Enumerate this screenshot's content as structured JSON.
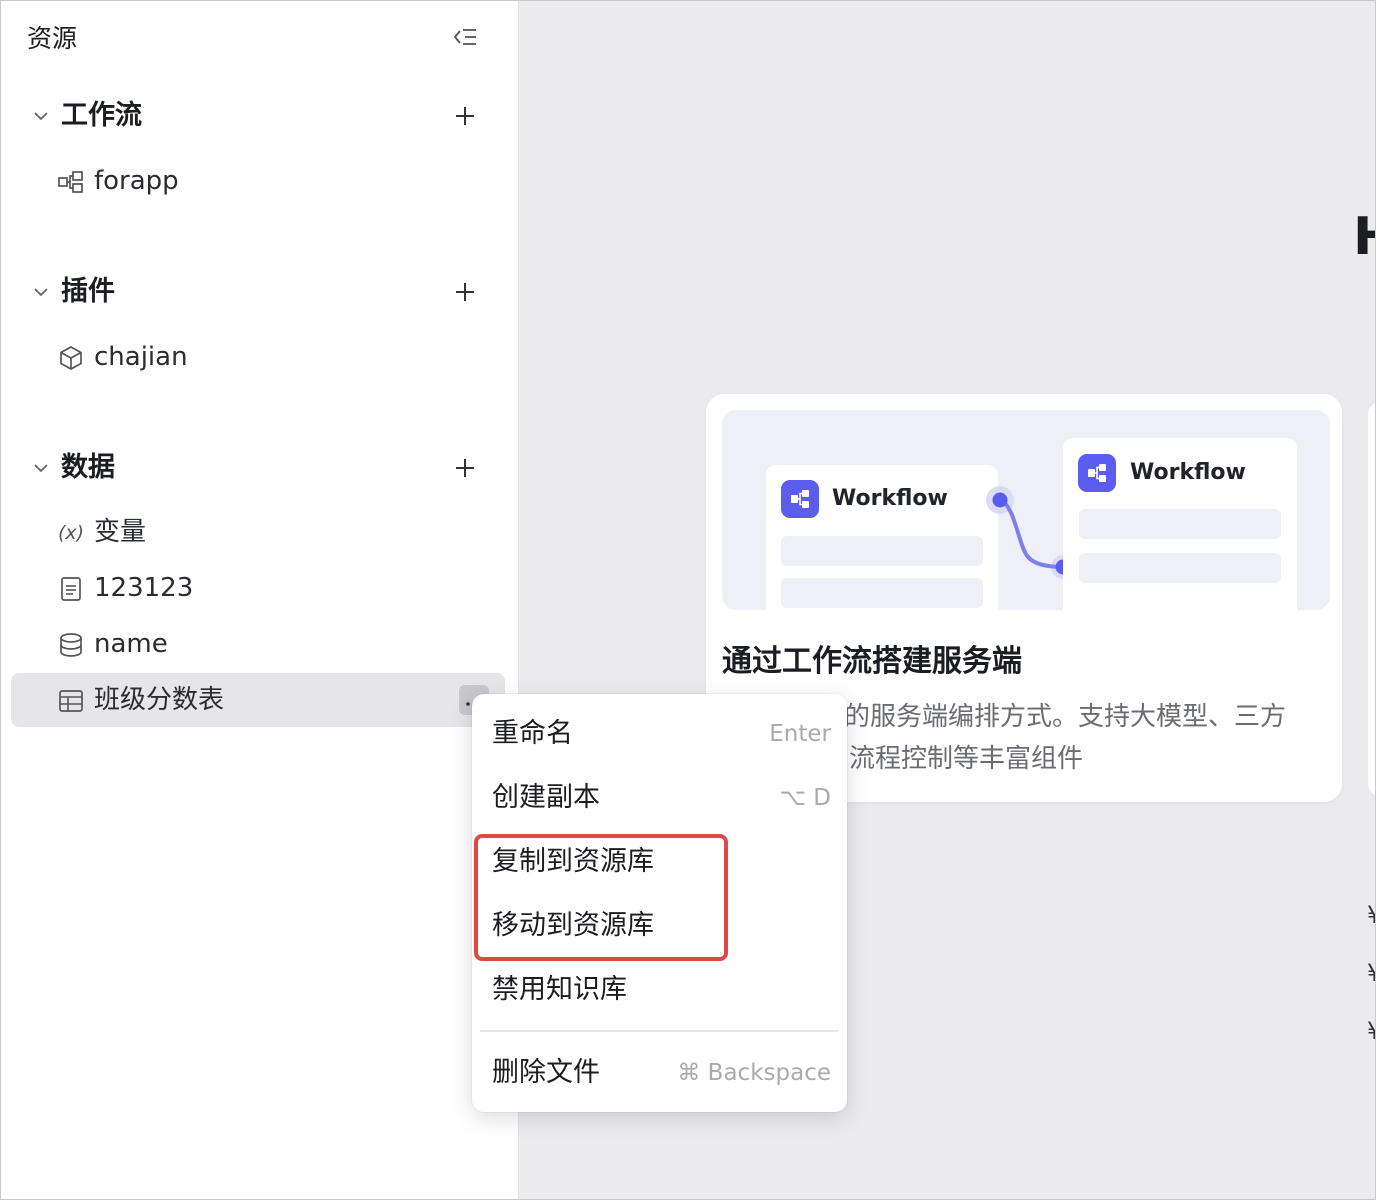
{
  "sidebar": {
    "title": "资源",
    "sections": [
      {
        "label": "工作流",
        "items": [
          {
            "icon": "workflow-icon",
            "label": "forapp"
          }
        ]
      },
      {
        "label": "插件",
        "items": [
          {
            "icon": "cube-icon",
            "label": "chajian"
          }
        ]
      },
      {
        "label": "数据",
        "items": [
          {
            "icon": "variable-icon",
            "label": "变量"
          },
          {
            "icon": "document-icon",
            "label": "123123"
          },
          {
            "icon": "database-icon",
            "label": "name"
          },
          {
            "icon": "table-icon",
            "label": "班级分数表"
          }
        ]
      }
    ],
    "variable_icon_glyph": "(x)"
  },
  "main": {
    "heading_partial": "H",
    "card": {
      "workflow_label_1": "Workflow",
      "workflow_label_2": "Workflow",
      "title": "通过工作流搭建服务端",
      "description_line1": "的服务端编排方式。支持大模型、三方",
      "description_line2": "流程控制等丰富组件"
    },
    "accent_color": "#5a5df0"
  },
  "context_menu": {
    "items": [
      {
        "label": "重命名",
        "shortcut": "Enter"
      },
      {
        "label": "创建副本",
        "shortcut": "⌥ D"
      },
      {
        "label": "复制到资源库",
        "shortcut": ""
      },
      {
        "label": "移动到资源库",
        "shortcut": ""
      },
      {
        "label": "禁用知识库",
        "shortcut": ""
      },
      {
        "label": "删除文件",
        "shortcut": "⌘ Backspace"
      }
    ],
    "highlight_color": "#e04848"
  }
}
